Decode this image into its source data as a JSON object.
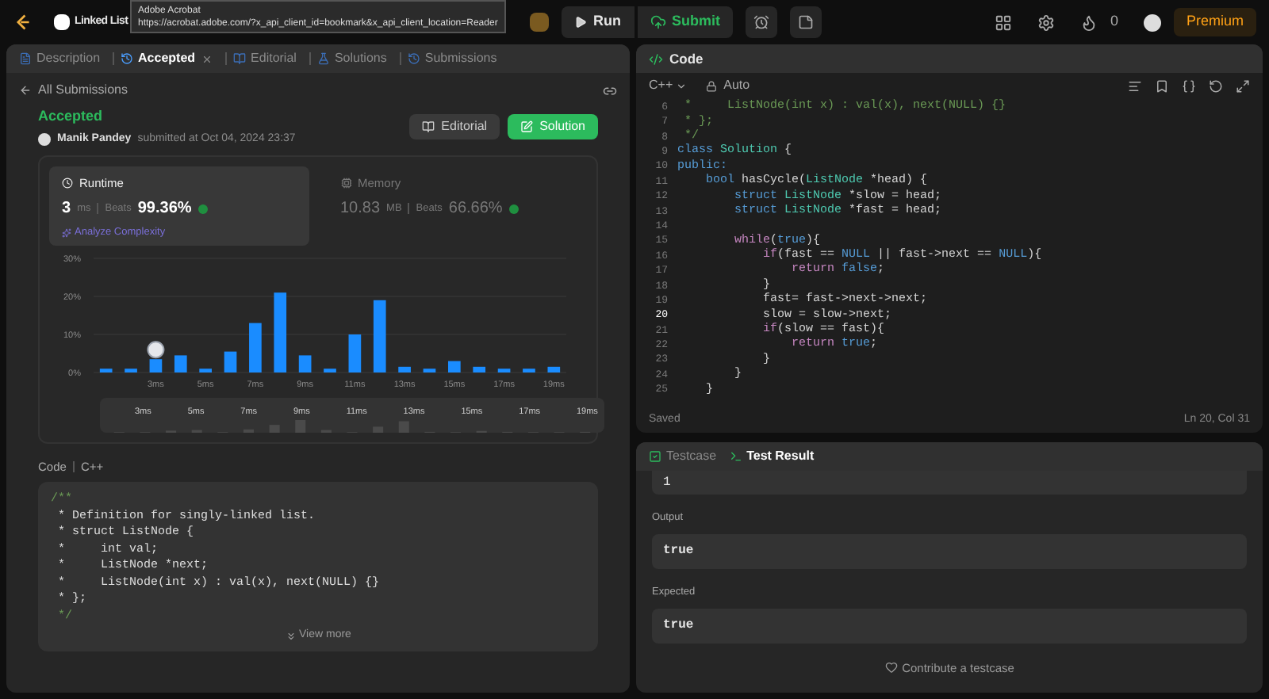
{
  "top_bar": {
    "problem_title": "Linked List",
    "run_label": "Run",
    "submit_label": "Submit",
    "streak_count": "0",
    "premium_label": "Premium"
  },
  "tooltip": {
    "title": "Adobe Acrobat",
    "url": "https://acrobat.adobe.com/?x_api_client_id=bookmark&x_api_client_location=Reader"
  },
  "left_tabs": [
    {
      "label": "Description",
      "selected": false,
      "closable": false
    },
    {
      "label": "Accepted",
      "selected": true,
      "closable": true
    },
    {
      "label": "Editorial",
      "selected": false,
      "closable": false
    },
    {
      "label": "Solutions",
      "selected": false,
      "closable": false
    },
    {
      "label": "Submissions",
      "selected": false,
      "closable": false
    }
  ],
  "back_link": "All Submissions",
  "submission": {
    "status": "Accepted",
    "author": "Manik Pandey",
    "submitted_text": "submitted at Oct 04, 2024 23:37",
    "editorial_button": "Editorial",
    "solution_button": "Solution"
  },
  "stats": [
    {
      "title": "Runtime",
      "selected": true,
      "value": "3",
      "unit": "ms",
      "beats_label": "Beats",
      "percent": "99.36%"
    },
    {
      "title": "Memory",
      "selected": false,
      "value": "10.83",
      "unit": "MB",
      "beats_label": "Beats",
      "percent": "66.66%"
    }
  ],
  "analyze_link": "Analyze Complexity",
  "chart_data": {
    "type": "bar",
    "x": [
      1,
      2,
      3,
      4,
      5,
      6,
      7,
      8,
      9,
      10,
      11,
      12,
      13,
      14,
      15,
      16,
      17,
      18,
      19
    ],
    "values": [
      1,
      1,
      3.5,
      4.5,
      1,
      5.5,
      13,
      21,
      4.5,
      1,
      10,
      19,
      1.5,
      1,
      3,
      1.5,
      1,
      1,
      1.5
    ],
    "xlim": [
      0.5,
      19.5
    ],
    "ylim": [
      0,
      30
    ],
    "yticks": [
      {
        "value": 0,
        "label": "0%"
      },
      {
        "value": 10,
        "label": "10%"
      },
      {
        "value": 20,
        "label": "20%"
      },
      {
        "value": 30,
        "label": "30%"
      }
    ],
    "xticks": [
      {
        "value": 3,
        "label": "3ms"
      },
      {
        "value": 5,
        "label": "5ms"
      },
      {
        "value": 7,
        "label": "7ms"
      },
      {
        "value": 9,
        "label": "9ms"
      },
      {
        "value": 11,
        "label": "11ms"
      },
      {
        "value": 13,
        "label": "13ms"
      },
      {
        "value": 15,
        "label": "15ms"
      },
      {
        "value": 17,
        "label": "17ms"
      },
      {
        "value": 19,
        "label": "19ms"
      }
    ]
  },
  "range_labels": [
    "3ms",
    "5ms",
    "7ms",
    "9ms",
    "11ms",
    "13ms",
    "15ms",
    "17ms",
    "19ms"
  ],
  "code_preview": {
    "label": "Code",
    "language": "C++",
    "view_more": "View more",
    "lines": [
      {
        "text": "/**",
        "kind": "comment"
      },
      {
        "text": " * Definition for singly-linked list.",
        "kind": "plain"
      },
      {
        "text": " * struct ListNode {",
        "kind": "plain"
      },
      {
        "text": " *     int val;",
        "kind": "plain"
      },
      {
        "text": " *     ListNode *next;",
        "kind": "plain"
      },
      {
        "text": " *     ListNode(int x) : val(x), next(NULL) {}",
        "kind": "plain"
      },
      {
        "text": " * };",
        "kind": "plain"
      },
      {
        "text": " */",
        "kind": "comment"
      }
    ]
  },
  "editor": {
    "title": "Code",
    "language": "C++",
    "mode": "Auto",
    "status": "Saved",
    "cursor": "Ln 20, Col 31",
    "lines": [
      {
        "n": "6",
        "current": false,
        "segments": [
          {
            "text": " *     ListNode(int x) : val(x), next(NULL) {}",
            "kind": "comment"
          }
        ]
      },
      {
        "n": "7",
        "current": false,
        "segments": [
          {
            "text": " * };",
            "kind": "comment"
          }
        ]
      },
      {
        "n": "8",
        "current": false,
        "segments": [
          {
            "text": " */",
            "kind": "comment"
          }
        ]
      },
      {
        "n": "9",
        "current": false,
        "segments": [
          {
            "text": "class",
            "kind": "keyword"
          },
          {
            "text": " Solution",
            "kind": "type"
          },
          {
            "text": " {",
            "kind": "plain"
          }
        ]
      },
      {
        "n": "10",
        "current": false,
        "segments": [
          {
            "text": "public:",
            "kind": "keyword"
          }
        ]
      },
      {
        "n": "11",
        "current": false,
        "segments": [
          {
            "text": "    bool",
            "kind": "keyword"
          },
          {
            "text": " hasCycle(",
            "kind": "plain"
          },
          {
            "text": "ListNode",
            "kind": "type"
          },
          {
            "text": " *head) {",
            "kind": "plain"
          }
        ]
      },
      {
        "n": "12",
        "current": false,
        "segments": [
          {
            "text": "        struct",
            "kind": "keyword"
          },
          {
            "text": " ListNode",
            "kind": "type"
          },
          {
            "text": " *slow = head;",
            "kind": "plain"
          }
        ]
      },
      {
        "n": "13",
        "current": false,
        "segments": [
          {
            "text": "        struct",
            "kind": "keyword"
          },
          {
            "text": " ListNode",
            "kind": "type"
          },
          {
            "text": " *fast = head;",
            "kind": "plain"
          }
        ]
      },
      {
        "n": "14",
        "current": false
      },
      {
        "n": "15",
        "current": false,
        "segments": [
          {
            "text": "        while",
            "kind": "control"
          },
          {
            "text": "(",
            "kind": "plain"
          },
          {
            "text": "true",
            "kind": "keyword"
          },
          {
            "text": "){",
            "kind": "plain"
          }
        ]
      },
      {
        "n": "16",
        "current": false,
        "segments": [
          {
            "text": "            if",
            "kind": "control"
          },
          {
            "text": "(fast == ",
            "kind": "plain"
          },
          {
            "text": "NULL",
            "kind": "keyword"
          },
          {
            "text": " || fast->next == ",
            "kind": "plain"
          },
          {
            "text": "NULL",
            "kind": "keyword"
          },
          {
            "text": "){",
            "kind": "plain"
          }
        ]
      },
      {
        "n": "17",
        "current": false,
        "segments": [
          {
            "text": "                return",
            "kind": "control"
          },
          {
            "text": " false",
            "kind": "keyword"
          },
          {
            "text": ";",
            "kind": "plain"
          }
        ]
      },
      {
        "n": "18",
        "current": false,
        "segments": [
          {
            "text": "            }",
            "kind": "plain"
          }
        ]
      },
      {
        "n": "19",
        "current": false,
        "segments": [
          {
            "text": "            fast= fast->next->next;",
            "kind": "plain"
          }
        ]
      },
      {
        "n": "20",
        "current": true,
        "segments": [
          {
            "text": "            slow = slow->next;",
            "kind": "plain"
          }
        ]
      },
      {
        "n": "21",
        "current": false,
        "segments": [
          {
            "text": "            if",
            "kind": "control"
          },
          {
            "text": "(slow == fast){",
            "kind": "plain"
          }
        ]
      },
      {
        "n": "22",
        "current": false,
        "segments": [
          {
            "text": "                return",
            "kind": "control"
          },
          {
            "text": " true",
            "kind": "keyword"
          },
          {
            "text": ";",
            "kind": "plain"
          }
        ]
      },
      {
        "n": "23",
        "current": false,
        "segments": [
          {
            "text": "            }",
            "kind": "plain"
          }
        ]
      },
      {
        "n": "24",
        "current": false,
        "segments": [
          {
            "text": "        }",
            "kind": "plain"
          }
        ]
      },
      {
        "n": "25",
        "current": false,
        "segments": [
          {
            "text": "    }",
            "kind": "plain"
          }
        ]
      }
    ]
  },
  "test_tabs": [
    {
      "label": "Testcase",
      "selected": false
    },
    {
      "label": "Test Result",
      "selected": true
    }
  ],
  "test_result": {
    "input_value": "1",
    "output_label": "Output",
    "output_value": "true",
    "expected_label": "Expected",
    "expected_value": "true",
    "contribute_label": "Contribute a testcase"
  }
}
